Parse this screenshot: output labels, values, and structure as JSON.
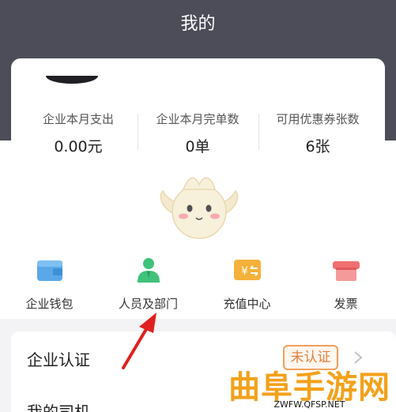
{
  "header": {
    "title": "我的"
  },
  "stats": [
    {
      "label": "企业本月支出",
      "value": "0.00元"
    },
    {
      "label": "企业本月完单数",
      "value": "0单"
    },
    {
      "label": "可用优惠券张数",
      "value": "6张"
    }
  ],
  "quick_actions": [
    {
      "label": "企业钱包",
      "icon": "wallet-icon",
      "color": "#5aa8e8"
    },
    {
      "label": "人员及部门",
      "icon": "person-icon",
      "color": "#3fc27a"
    },
    {
      "label": "充值中心",
      "icon": "recharge-icon",
      "color": "#f5b13a"
    },
    {
      "label": "发票",
      "icon": "invoice-icon",
      "color": "#f07070"
    }
  ],
  "menu": {
    "company_verify": {
      "label": "企业认证",
      "status": "未认证"
    },
    "my_drivers": {
      "label": "我的司机"
    }
  },
  "watermark": {
    "title": "曲阜手游网",
    "url": "ZWFW.QFSP.NET"
  },
  "colors": {
    "header_bg": "#4c4d59",
    "badge_orange": "#e8803a",
    "arrow_red": "#e02020",
    "watermark_orange": "#f4a11b"
  }
}
